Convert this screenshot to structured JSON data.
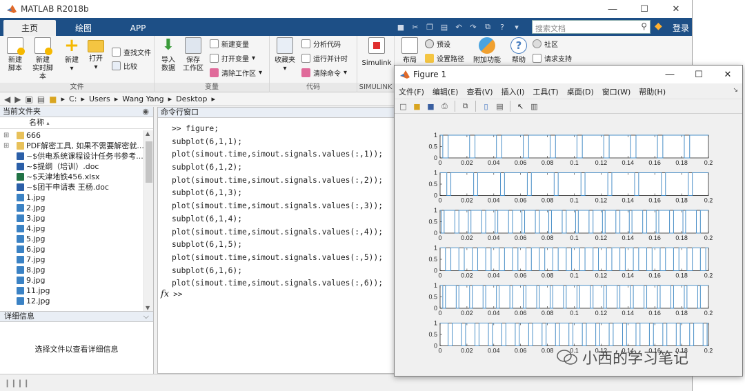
{
  "app": {
    "title": "MATLAB R2018b",
    "tabs": [
      "主页",
      "绘图",
      "APP"
    ],
    "search_placeholder": "搜索文档",
    "login": "登录"
  },
  "ribbon": {
    "file_group": {
      "label": "文件",
      "new_script": "新建\n脚本",
      "new_live_script": "新建\n实时脚本",
      "new": "新建",
      "open": "打开",
      "find_files": "查找文件",
      "compare": "比较"
    },
    "variable_group": {
      "label": "变量",
      "import_data": "导入\n数据",
      "save_workspace": "保存\n工作区",
      "new_variable": "新建变量",
      "open_variable": "打开变量",
      "clear_workspace": "清除工作区"
    },
    "code_group": {
      "label": "代码",
      "favorites": "收藏夹",
      "analyze_code": "分析代码",
      "run_and_time": "运行并计时",
      "clear_commands": "清除命令"
    },
    "simulink_group": {
      "label": "SIMULINK",
      "simulink": "Simulink"
    },
    "env_group": {
      "layout": "布局",
      "preferences": "预设",
      "set_path": "设置路径",
      "addons": "附加功能",
      "help": "帮助",
      "community": "社区",
      "request_support": "请求支持"
    }
  },
  "address": {
    "crumbs": [
      "C:",
      "Users",
      "Wang Yang",
      "Desktop"
    ]
  },
  "file_panel": {
    "title": "当前文件夹",
    "column": "名称",
    "items": [
      {
        "name": "666",
        "kind": "folder"
      },
      {
        "name": "PDF解密工具, 如果不需要解密就...",
        "kind": "folder"
      },
      {
        "name": "~$供电系统课程设计任务书参考...",
        "kind": "doc"
      },
      {
        "name": "~$提纲（培训）.doc",
        "kind": "doc"
      },
      {
        "name": "~$天津地铁456.xlsx",
        "kind": "xls"
      },
      {
        "name": "~$团干申请表 王杨.doc",
        "kind": "doc"
      },
      {
        "name": "1.jpg",
        "kind": "img"
      },
      {
        "name": "2.jpg",
        "kind": "img"
      },
      {
        "name": "3.jpg",
        "kind": "img"
      },
      {
        "name": "4.jpg",
        "kind": "img"
      },
      {
        "name": "5.jpg",
        "kind": "img"
      },
      {
        "name": "6.jpg",
        "kind": "img"
      },
      {
        "name": "7.jpg",
        "kind": "img"
      },
      {
        "name": "8.jpg",
        "kind": "img"
      },
      {
        "name": "9.jpg",
        "kind": "img"
      },
      {
        "name": "11.jpg",
        "kind": "img"
      },
      {
        "name": "12.jpg",
        "kind": "img"
      }
    ],
    "details_title": "详细信息",
    "details_text": "选择文件以查看详细信息"
  },
  "command_window": {
    "title": "命令行窗口",
    "lines": [
      ">> figure;",
      "subplot(6,1,1);",
      "plot(simout.time,simout.signals.values(:,1));",
      "subplot(6,1,2);",
      "plot(simout.time,simout.signals.values(:,2));",
      "subplot(6,1,3);",
      "plot(simout.time,simout.signals.values(:,3));",
      "subplot(6,1,4);",
      "plot(simout.time,simout.signals.values(:,4));",
      "subplot(6,1,5);",
      "plot(simout.time,simout.signals.values(:,5));",
      "subplot(6,1,6);",
      "plot(simout.time,simout.signals.values(:,6));"
    ],
    "prompt": ">>",
    "fx": "fx"
  },
  "figure": {
    "title": "Figure 1",
    "menu": [
      "文件(F)",
      "编辑(E)",
      "查看(V)",
      "插入(I)",
      "工具(T)",
      "桌面(D)",
      "窗口(W)",
      "帮助(H)"
    ],
    "line_color": "#4a8fc7",
    "x_ticks": [
      "0",
      "0.02",
      "0.04",
      "0.06",
      "0.08",
      "0.1",
      "0.12",
      "0.14",
      "0.16",
      "0.18",
      "0.2"
    ],
    "y_ticks": [
      "0",
      "0.5",
      "1"
    ]
  },
  "chart_data": [
    {
      "type": "line",
      "xlim": [
        0,
        0.2
      ],
      "ylim": [
        0,
        1
      ],
      "title": "",
      "xlabel": "",
      "ylabel": "",
      "series": [
        {
          "x": [
            0,
            0.002,
            0.002,
            0.006,
            0.006,
            0.022,
            0.022,
            0.026,
            0.026,
            0.042,
            0.042,
            0.046,
            0.046,
            0.062,
            0.062,
            0.066,
            0.066,
            0.082,
            0.082,
            0.086,
            0.086,
            0.102,
            0.102,
            0.106,
            0.106,
            0.122,
            0.122,
            0.126,
            0.126,
            0.142,
            0.142,
            0.146,
            0.146,
            0.162,
            0.162,
            0.166,
            0.166,
            0.182,
            0.182,
            0.186,
            0.186,
            0.2
          ],
          "y": [
            1,
            1,
            0,
            0,
            1,
            1,
            0,
            0,
            1,
            1,
            0,
            0,
            1,
            1,
            0,
            0,
            1,
            1,
            0,
            0,
            1,
            1,
            0,
            0,
            1,
            1,
            0,
            0,
            1,
            1,
            0,
            0,
            1,
            1,
            0,
            0,
            1,
            1,
            0,
            0,
            1,
            1
          ]
        }
      ]
    },
    {
      "type": "line",
      "xlim": [
        0,
        0.2
      ],
      "ylim": [
        0,
        1
      ],
      "title": "",
      "xlabel": "",
      "ylabel": "",
      "series": [
        {
          "x": [
            0,
            0.005,
            0.005,
            0.008,
            0.008,
            0.025,
            0.025,
            0.028,
            0.028,
            0.045,
            0.045,
            0.048,
            0.048,
            0.065,
            0.065,
            0.068,
            0.068,
            0.085,
            0.085,
            0.088,
            0.088,
            0.105,
            0.105,
            0.108,
            0.108,
            0.125,
            0.125,
            0.128,
            0.128,
            0.145,
            0.145,
            0.148,
            0.148,
            0.165,
            0.165,
            0.168,
            0.168,
            0.185,
            0.185,
            0.188,
            0.188,
            0.2
          ],
          "y": [
            1,
            1,
            0,
            0,
            1,
            1,
            0,
            0,
            1,
            1,
            0,
            0,
            1,
            1,
            0,
            0,
            1,
            1,
            0,
            0,
            1,
            1,
            0,
            0,
            1,
            1,
            0,
            0,
            1,
            1,
            0,
            0,
            1,
            1,
            0,
            0,
            1,
            1,
            0,
            0,
            1,
            1
          ]
        }
      ]
    },
    {
      "type": "line",
      "xlim": [
        0,
        0.2
      ],
      "ylim": [
        0,
        1
      ],
      "title": "",
      "xlabel": "",
      "ylabel": "",
      "series": [
        {
          "x": [
            0,
            0.001,
            0.001,
            0.003,
            0.003,
            0.011,
            0.011,
            0.014,
            0.014,
            0.021,
            0.021,
            0.023,
            0.023,
            0.031,
            0.031,
            0.034,
            0.034,
            0.041,
            0.041,
            0.043,
            0.043,
            0.051,
            0.051,
            0.054,
            0.054,
            0.061,
            0.061,
            0.063,
            0.063,
            0.071,
            0.071,
            0.074,
            0.074,
            0.081,
            0.081,
            0.083,
            0.083,
            0.091,
            0.091,
            0.094,
            0.094,
            0.101,
            0.101,
            0.103,
            0.103,
            0.111,
            0.111,
            0.114,
            0.114,
            0.121,
            0.121,
            0.123,
            0.123,
            0.131,
            0.131,
            0.134,
            0.134,
            0.141,
            0.141,
            0.143,
            0.143,
            0.151,
            0.151,
            0.154,
            0.154,
            0.161,
            0.161,
            0.163,
            0.163,
            0.171,
            0.171,
            0.174,
            0.174,
            0.181,
            0.181,
            0.183,
            0.183,
            0.191,
            0.191,
            0.194,
            0.194,
            0.2
          ],
          "y": [
            1,
            1,
            0,
            0,
            1,
            1,
            0,
            0,
            1,
            1,
            0,
            0,
            1,
            1,
            0,
            0,
            1,
            1,
            0,
            0,
            1,
            1,
            0,
            0,
            1,
            1,
            0,
            0,
            1,
            1,
            0,
            0,
            1,
            1,
            0,
            0,
            1,
            1,
            0,
            0,
            1,
            1,
            0,
            0,
            1,
            1,
            0,
            0,
            1,
            1,
            0,
            0,
            1,
            1,
            0,
            0,
            1,
            1,
            0,
            0,
            1,
            1,
            0,
            0,
            1,
            1,
            0,
            0,
            1,
            1,
            0,
            0,
            1,
            1,
            0,
            0,
            1,
            1,
            0,
            0,
            1,
            1
          ]
        }
      ]
    },
    {
      "type": "line",
      "xlim": [
        0,
        0.2
      ],
      "ylim": [
        0,
        1
      ],
      "title": "",
      "xlabel": "",
      "ylabel": "",
      "series": [
        {
          "x": [
            0,
            0.004,
            0.004,
            0.008,
            0.008,
            0.014,
            0.014,
            0.018,
            0.018,
            0.024,
            0.024,
            0.028,
            0.028,
            0.034,
            0.034,
            0.038,
            0.038,
            0.044,
            0.044,
            0.048,
            0.048,
            0.054,
            0.054,
            0.058,
            0.058,
            0.064,
            0.064,
            0.068,
            0.068,
            0.074,
            0.074,
            0.078,
            0.078,
            0.084,
            0.084,
            0.088,
            0.088,
            0.094,
            0.094,
            0.098,
            0.098,
            0.104,
            0.104,
            0.108,
            0.108,
            0.114,
            0.114,
            0.118,
            0.118,
            0.124,
            0.124,
            0.128,
            0.128,
            0.134,
            0.134,
            0.138,
            0.138,
            0.144,
            0.144,
            0.148,
            0.148,
            0.154,
            0.154,
            0.158,
            0.158,
            0.164,
            0.164,
            0.168,
            0.168,
            0.174,
            0.174,
            0.178,
            0.178,
            0.184,
            0.184,
            0.188,
            0.188,
            0.194,
            0.194,
            0.198,
            0.198,
            0.2
          ],
          "y": [
            1,
            1,
            0,
            0,
            1,
            1,
            0,
            0,
            1,
            1,
            0,
            0,
            1,
            1,
            0,
            0,
            1,
            1,
            0,
            0,
            1,
            1,
            0,
            0,
            1,
            1,
            0,
            0,
            1,
            1,
            0,
            0,
            1,
            1,
            0,
            0,
            1,
            1,
            0,
            0,
            1,
            1,
            0,
            0,
            1,
            1,
            0,
            0,
            1,
            1,
            0,
            0,
            1,
            1,
            0,
            0,
            1,
            1,
            0,
            0,
            1,
            1,
            0,
            0,
            1,
            1,
            0,
            0,
            1,
            1,
            0,
            0,
            1,
            1,
            0,
            0,
            1,
            1,
            0,
            0,
            1,
            1
          ]
        }
      ]
    },
    {
      "type": "line",
      "xlim": [
        0,
        0.2
      ],
      "ylim": [
        0,
        1
      ],
      "title": "",
      "xlabel": "",
      "ylabel": "",
      "series": [
        {
          "x": [
            0,
            0.002,
            0.002,
            0.004,
            0.004,
            0.012,
            0.012,
            0.014,
            0.014,
            0.022,
            0.022,
            0.024,
            0.024,
            0.032,
            0.032,
            0.034,
            0.034,
            0.042,
            0.042,
            0.044,
            0.044,
            0.052,
            0.052,
            0.054,
            0.054,
            0.062,
            0.062,
            0.064,
            0.064,
            0.072,
            0.072,
            0.074,
            0.074,
            0.082,
            0.082,
            0.084,
            0.084,
            0.092,
            0.092,
            0.094,
            0.094,
            0.102,
            0.102,
            0.104,
            0.104,
            0.112,
            0.112,
            0.114,
            0.114,
            0.122,
            0.122,
            0.124,
            0.124,
            0.132,
            0.132,
            0.134,
            0.134,
            0.142,
            0.142,
            0.144,
            0.144,
            0.152,
            0.152,
            0.154,
            0.154,
            0.162,
            0.162,
            0.164,
            0.164,
            0.172,
            0.172,
            0.174,
            0.174,
            0.182,
            0.182,
            0.184,
            0.184,
            0.192,
            0.192,
            0.194,
            0.194,
            0.2
          ],
          "y": [
            1,
            1,
            0,
            0,
            1,
            1,
            0,
            0,
            1,
            1,
            0,
            0,
            1,
            1,
            0,
            0,
            1,
            1,
            0,
            0,
            1,
            1,
            0,
            0,
            1,
            1,
            0,
            0,
            1,
            1,
            0,
            0,
            1,
            1,
            0,
            0,
            1,
            1,
            0,
            0,
            1,
            1,
            0,
            0,
            1,
            1,
            0,
            0,
            1,
            1,
            0,
            0,
            1,
            1,
            0,
            0,
            1,
            1,
            0,
            0,
            1,
            1,
            0,
            0,
            1,
            1,
            0,
            0,
            1,
            1,
            0,
            0,
            1,
            1,
            0,
            0,
            1,
            1,
            0,
            0,
            1,
            1
          ]
        }
      ]
    },
    {
      "type": "line",
      "xlim": [
        0,
        0.2
      ],
      "ylim": [
        0,
        1
      ],
      "title": "",
      "xlabel": "",
      "ylabel": "",
      "series": [
        {
          "x": [
            0,
            0.006,
            0.006,
            0.009,
            0.009,
            0.016,
            0.016,
            0.019,
            0.019,
            0.026,
            0.026,
            0.029,
            0.029,
            0.036,
            0.036,
            0.039,
            0.039,
            0.046,
            0.046,
            0.049,
            0.049,
            0.056,
            0.056,
            0.059,
            0.059,
            0.066,
            0.066,
            0.069,
            0.069,
            0.076,
            0.076,
            0.079,
            0.079,
            0.086,
            0.086,
            0.089,
            0.089,
            0.096,
            0.096,
            0.099,
            0.099,
            0.106,
            0.106,
            0.109,
            0.109,
            0.116,
            0.116,
            0.119,
            0.119,
            0.126,
            0.126,
            0.129,
            0.129,
            0.136,
            0.136,
            0.139,
            0.139,
            0.146,
            0.146,
            0.149,
            0.149,
            0.156,
            0.156,
            0.159,
            0.159,
            0.166,
            0.166,
            0.169,
            0.169,
            0.176,
            0.176,
            0.179,
            0.179,
            0.186,
            0.186,
            0.189,
            0.189,
            0.196,
            0.196,
            0.199,
            0.199,
            0.2
          ],
          "y": [
            1,
            1,
            0,
            0,
            1,
            1,
            0,
            0,
            1,
            1,
            0,
            0,
            1,
            1,
            0,
            0,
            1,
            1,
            0,
            0,
            1,
            1,
            0,
            0,
            1,
            1,
            0,
            0,
            1,
            1,
            0,
            0,
            1,
            1,
            0,
            0,
            1,
            1,
            0,
            0,
            1,
            1,
            0,
            0,
            1,
            1,
            0,
            0,
            1,
            1,
            0,
            0,
            1,
            1,
            0,
            0,
            1,
            1,
            0,
            0,
            1,
            1,
            0,
            0,
            1,
            1,
            0,
            0,
            1,
            1,
            0,
            0,
            1,
            1,
            0,
            0,
            1,
            1,
            0,
            0,
            1,
            1
          ]
        }
      ]
    }
  ],
  "watermark": "小西的学习笔记"
}
